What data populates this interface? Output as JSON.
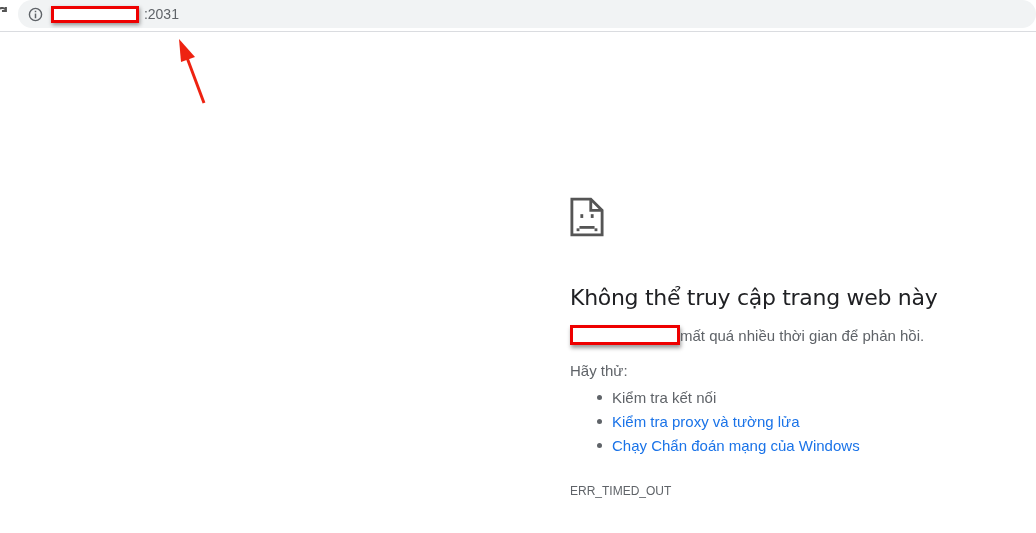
{
  "address_bar": {
    "url": ":2031"
  },
  "error_page": {
    "heading": "Không thể truy cập trang web này",
    "message": "mất quá nhiều thời gian để phản hồi.",
    "suggestions_label": "Hãy thử:",
    "suggestions": [
      {
        "kind": "text",
        "label": "Kiểm tra kết nối"
      },
      {
        "kind": "link",
        "label": "Kiểm tra proxy và tường lửa"
      },
      {
        "kind": "link",
        "label": "Chạy Chẩn đoán mạng của Windows"
      }
    ],
    "error_code": "ERR_TIMED_OUT"
  }
}
